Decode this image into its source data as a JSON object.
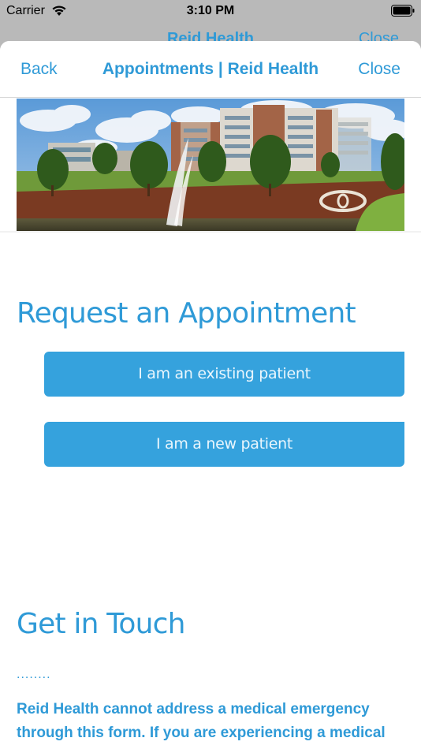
{
  "status_bar": {
    "carrier": "Carrier",
    "time": "3:10 PM"
  },
  "parent_header": {
    "title": "Reid Health",
    "close_label": "Close"
  },
  "navbar": {
    "back_label": "Back",
    "title": "Appointments | Reid Health",
    "close_label": "Close"
  },
  "hero": {
    "alt": "Reid Health hospital campus with fountain"
  },
  "request": {
    "heading": "Request an Appointment",
    "existing_patient_label": "I am an existing patient",
    "new_patient_label": "I am a new patient"
  },
  "contact": {
    "heading": "Get in Touch",
    "divider": "........",
    "notice": "Reid Health cannot address a medical emergency through this form. If you are experiencing a medical"
  },
  "colors": {
    "accent": "#2f9ad7",
    "button": "#35a2dd"
  }
}
